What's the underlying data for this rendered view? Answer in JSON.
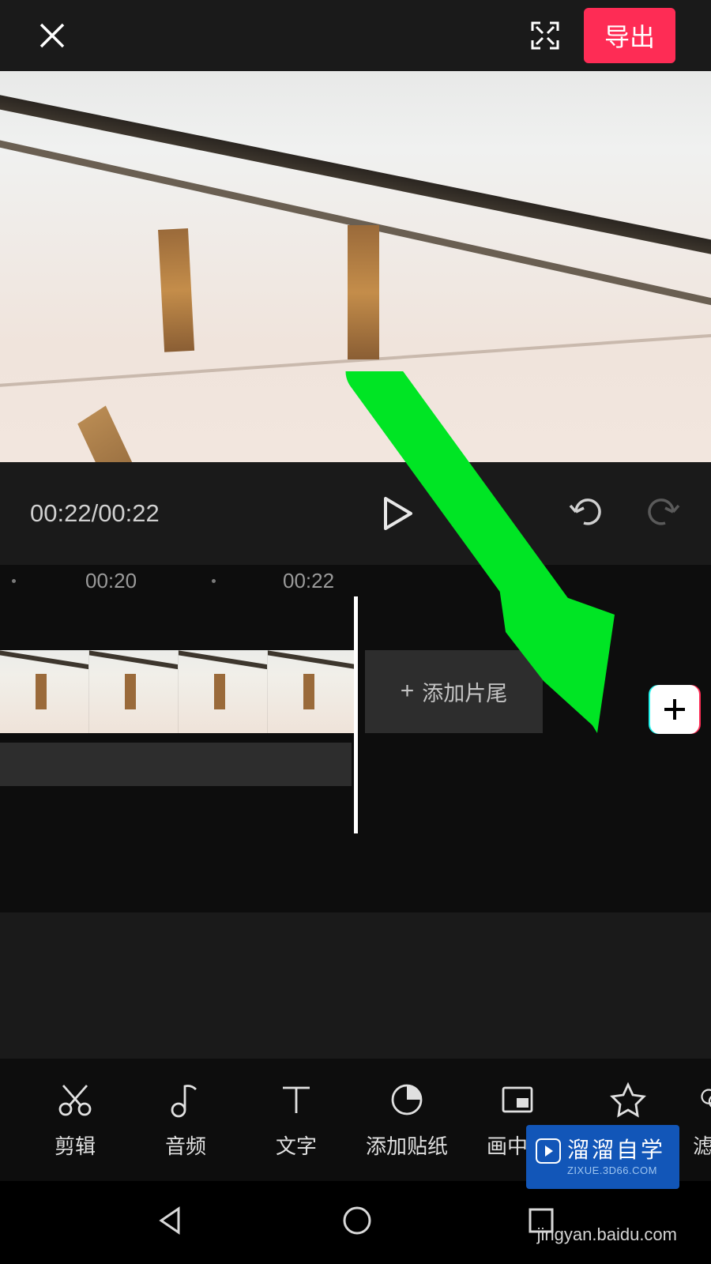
{
  "header": {
    "export_label": "导出"
  },
  "playback": {
    "time_display": "00:22/00:22"
  },
  "ruler": {
    "marks": [
      "00:20",
      "00:22"
    ]
  },
  "timeline": {
    "add_ending_label": "添加片尾"
  },
  "tools": [
    {
      "id": "cut",
      "label": "剪辑"
    },
    {
      "id": "audio",
      "label": "音频"
    },
    {
      "id": "text",
      "label": "文字"
    },
    {
      "id": "sticker",
      "label": "添加贴纸"
    },
    {
      "id": "pip",
      "label": "画中画"
    },
    {
      "id": "effect",
      "label": "特效"
    },
    {
      "id": "filter",
      "label": "滤"
    }
  ],
  "watermark": {
    "main": "溜溜自学",
    "sub": "ZIXUE.3D66.COM"
  },
  "footer_text": "jingyan.baidu.com",
  "colors": {
    "accent": "#fe2c55",
    "arrow": "#00e524"
  }
}
